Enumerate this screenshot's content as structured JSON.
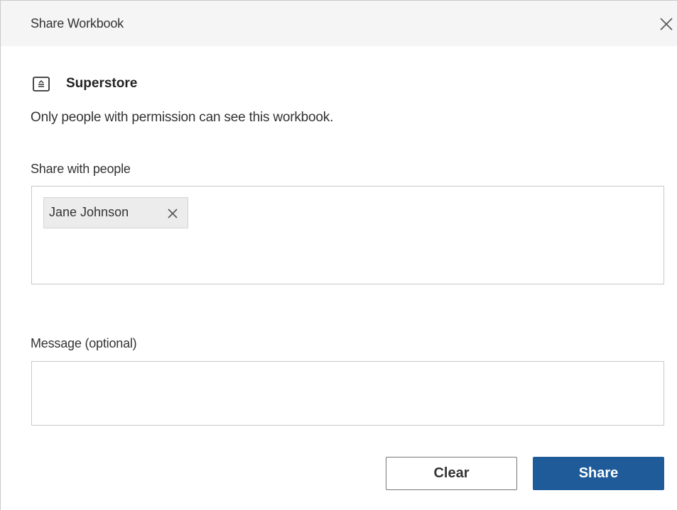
{
  "dialog": {
    "title": "Share Workbook",
    "close_icon": "close-icon"
  },
  "workbook": {
    "icon": "workbook-icon",
    "name": "Superstore",
    "permission_note": "Only people with permission can see this workbook."
  },
  "share_with": {
    "label": "Share with people",
    "chips": [
      {
        "label": "Jane Johnson",
        "remove_icon": "close-icon"
      }
    ]
  },
  "message": {
    "label": "Message (optional)",
    "value": "",
    "placeholder": ""
  },
  "buttons": {
    "clear_label": "Clear",
    "share_label": "Share"
  },
  "colors": {
    "titlebar_bg": "#f5f5f5",
    "primary": "#1f5b99",
    "chip_bg": "#ececec",
    "border": "#c8c8c8"
  }
}
